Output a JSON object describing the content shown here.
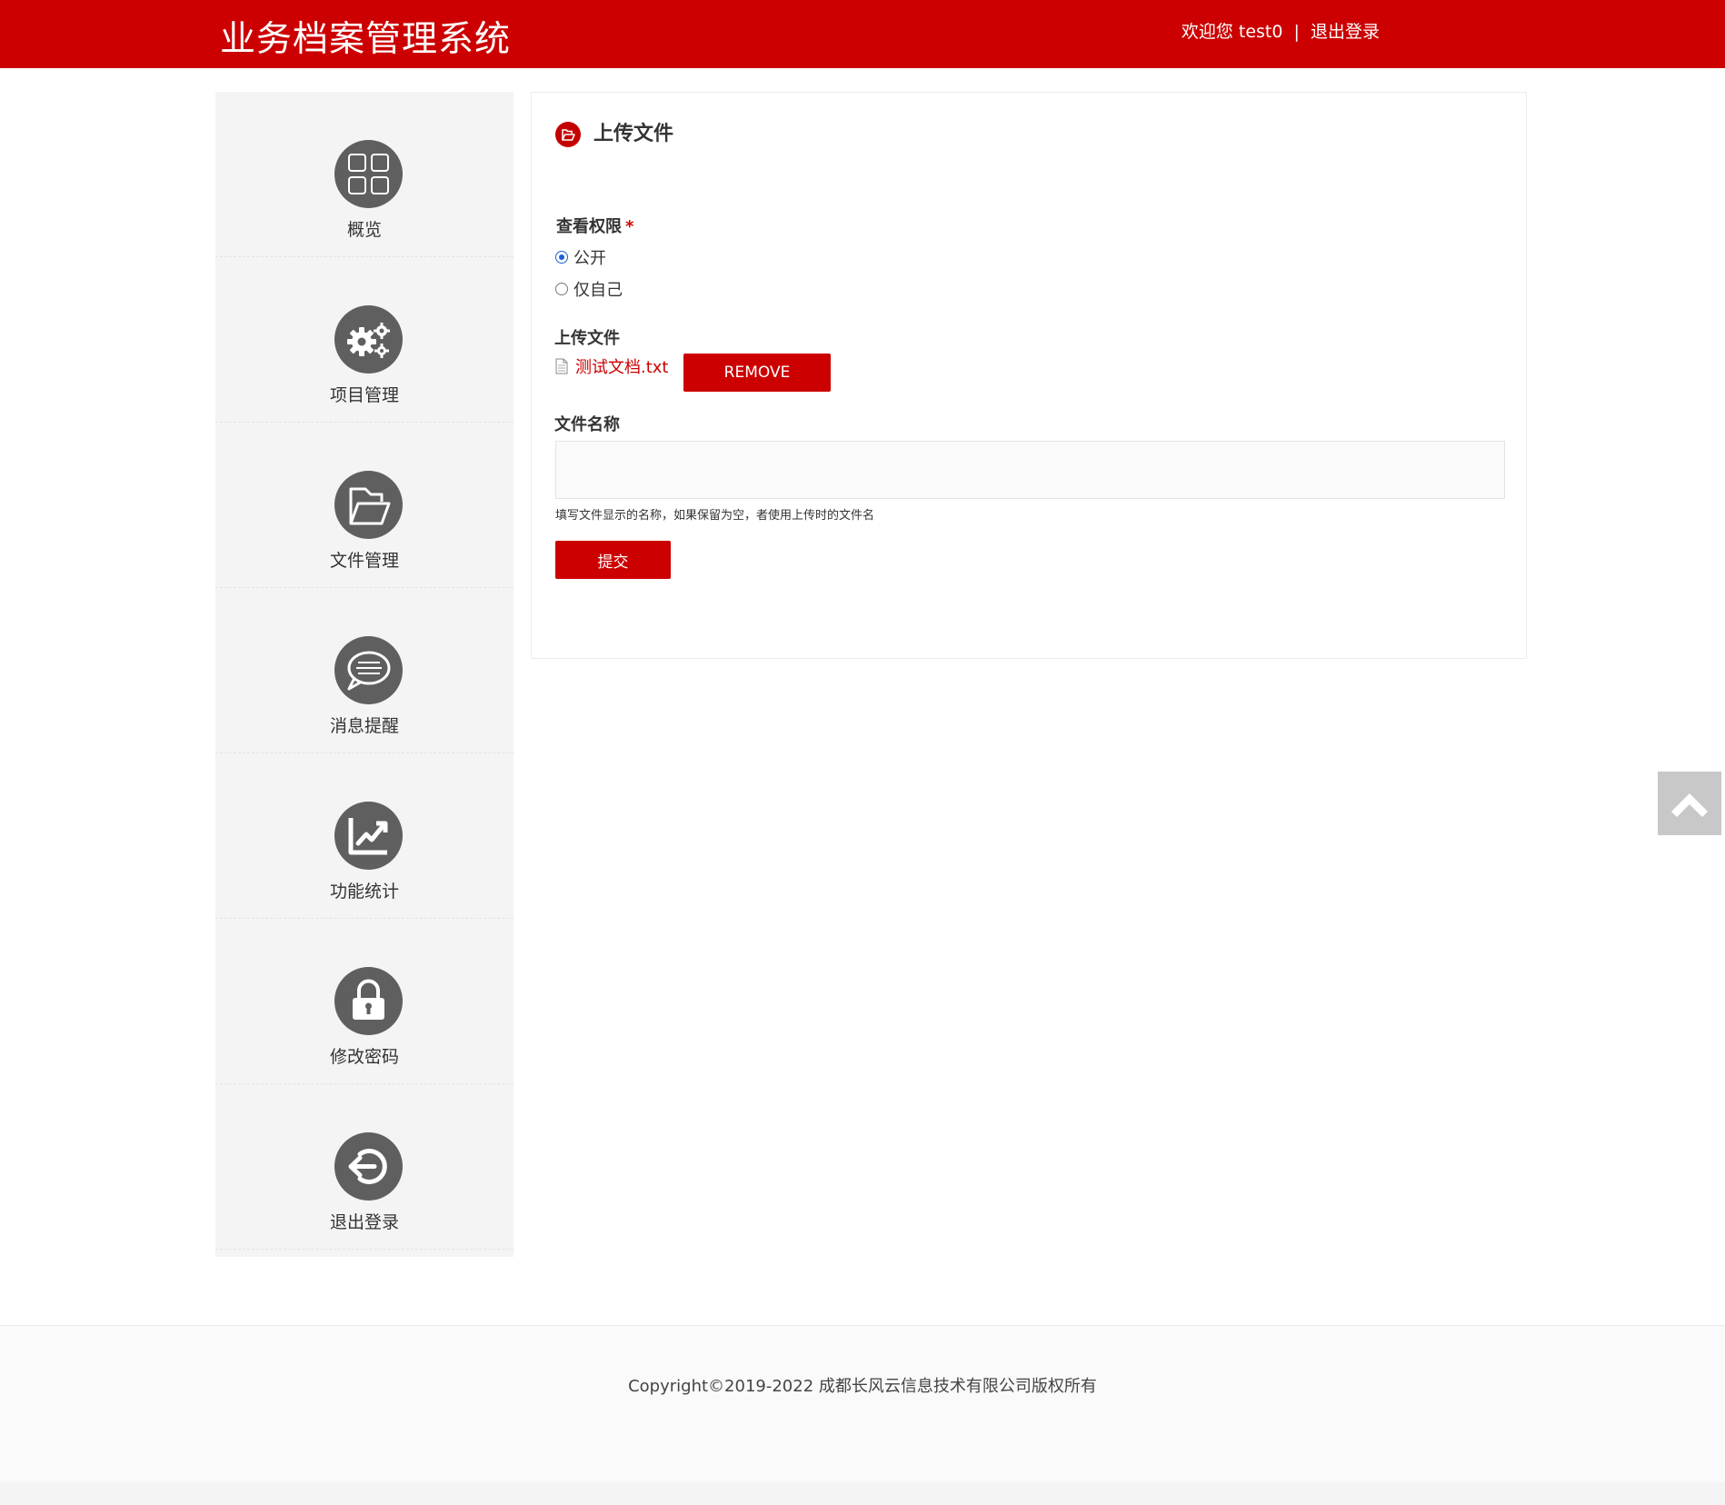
{
  "header": {
    "title": "业务档案管理系统",
    "welcome": "欢迎您 test0",
    "separator": "|",
    "logout": "退出登录"
  },
  "sidebar": {
    "items": [
      {
        "label": "概览",
        "icon": "grid-icon"
      },
      {
        "label": "项目管理",
        "icon": "gears-icon"
      },
      {
        "label": "文件管理",
        "icon": "folder-open-icon"
      },
      {
        "label": "消息提醒",
        "icon": "chat-bubble-icon"
      },
      {
        "label": "功能统计",
        "icon": "chart-line-icon"
      },
      {
        "label": "修改密码",
        "icon": "lock-icon"
      },
      {
        "label": "退出登录",
        "icon": "logout-icon"
      }
    ]
  },
  "panel": {
    "title": "上传文件",
    "permission": {
      "label": "查看权限",
      "required_mark": "*",
      "options": [
        {
          "label": "公开",
          "checked": true
        },
        {
          "label": "仅自己",
          "checked": false
        }
      ]
    },
    "upload": {
      "label": "上传文件",
      "file_name": "测试文档.txt",
      "remove_label": "REMOVE"
    },
    "filename_field": {
      "label": "文件名称",
      "value": "",
      "hint": "填写文件显示的名称，如果保留为空，者使用上传时的文件名"
    },
    "submit_label": "提交"
  },
  "footer": {
    "copyright": "Copyright©2019-2022  成都长风云信息技术有限公司版权所有"
  },
  "colors": {
    "brand_red": "#cc0000",
    "sidebar_bg": "#f4f4f4",
    "icon_gray": "#5f5f5f",
    "radio_blue": "#1a5fd1"
  }
}
